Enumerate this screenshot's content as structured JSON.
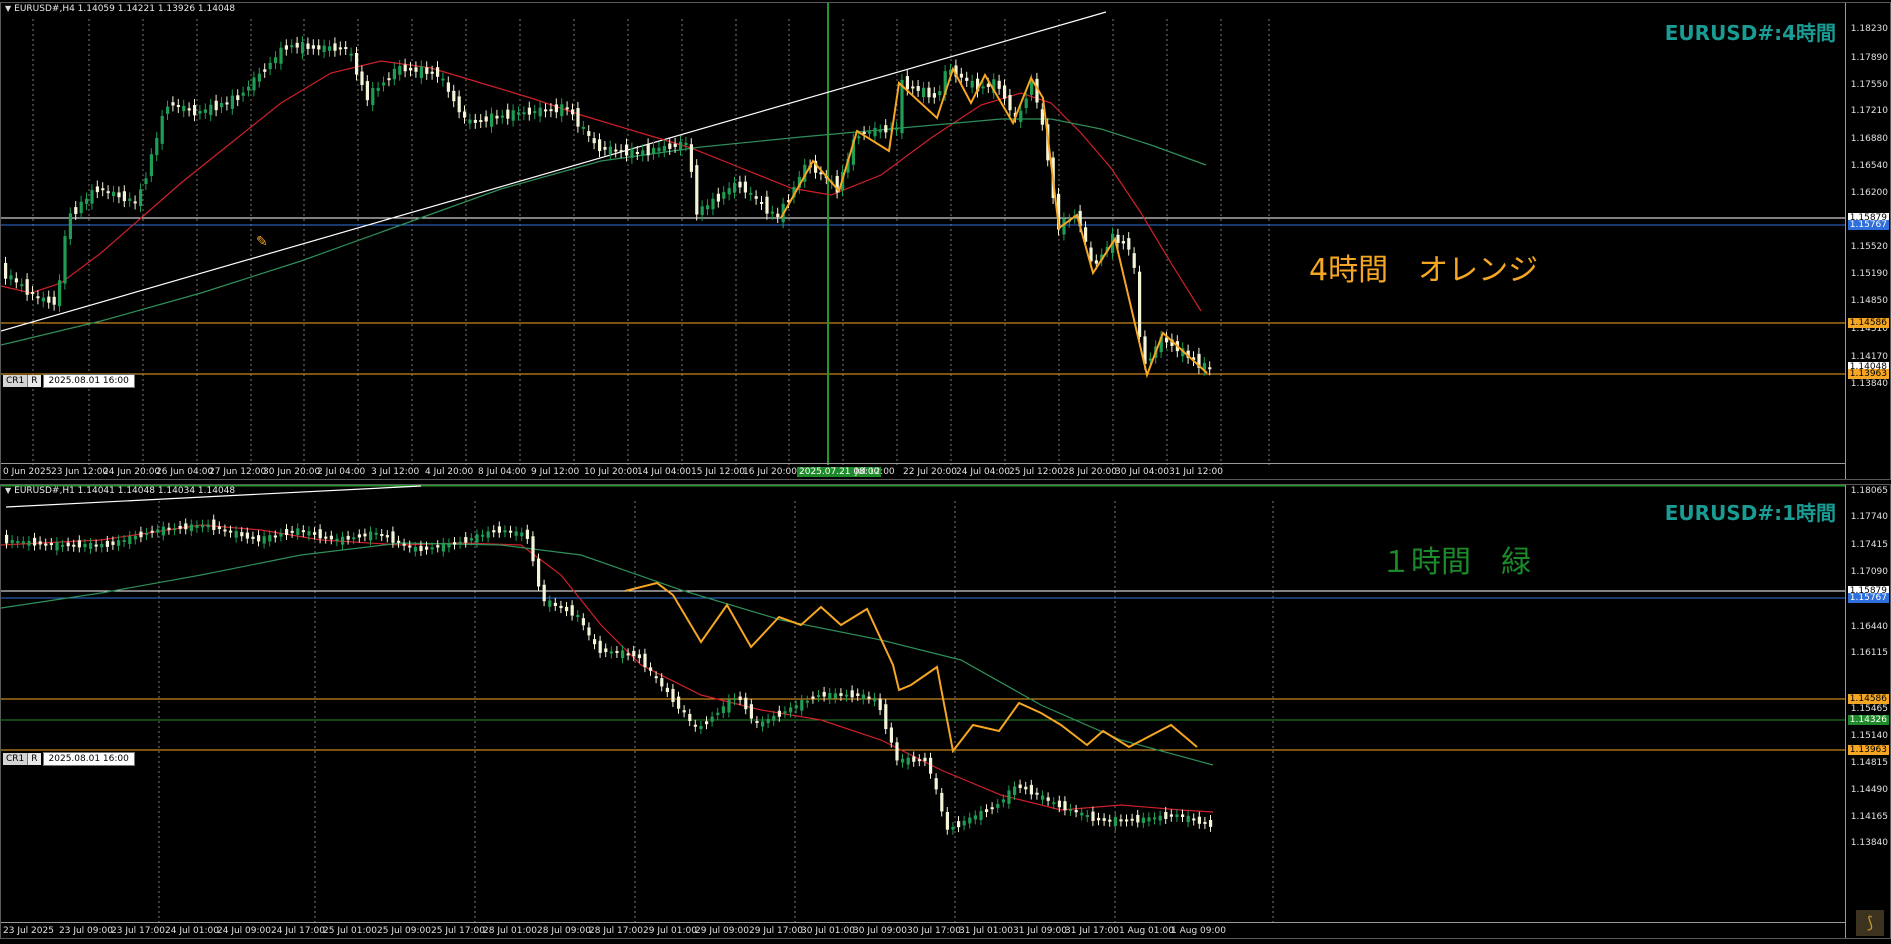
{
  "top": {
    "header": "EURUSD#,H4  1.14059 1.14221 1.13926 1.14048",
    "watermark": "EURUSD#:4時間",
    "annotation": "4時間　オレンジ",
    "annotation_color": "#f5a623",
    "date_box": "2025.08.01 16:00",
    "cr": "CR1",
    "r": "R",
    "price_ticks": [
      "1.18230",
      "1.17890",
      "1.17550",
      "1.17210",
      "1.16880",
      "1.16540",
      "1.16200",
      "1.15520",
      "1.15190",
      "1.14850",
      "1.14510",
      "1.14170",
      "1.13840"
    ],
    "price_boxes": [
      {
        "label": "1.15879",
        "bg": "#ffffff",
        "fg": "#000000"
      },
      {
        "label": "1.15767",
        "bg": "#2f6fdc",
        "fg": "#ffffff"
      },
      {
        "label": "1.14586",
        "bg": "#f5a623",
        "fg": "#000000"
      },
      {
        "label": "1.14048",
        "bg": "#ffffff",
        "fg": "#000000"
      },
      {
        "label": "1.13963",
        "bg": "#f5a623",
        "fg": "#000000"
      }
    ],
    "time_ticks": [
      "0 Jun 2025",
      "23 Jun 12:00",
      "24 Jun 20:00",
      "26 Jun 04:00",
      "27 Jun 12:00",
      "30 Jun 20:00",
      "2 Jul 04:00",
      "3 Jul 12:00",
      "4 Jul 20:00",
      "8 Jul 04:00",
      "9 Jul 12:00",
      "10 Jul 20:00",
      "14 Jul 04:00",
      "15 Jul 12:00",
      "16 Jul 20:00",
      "2025.07.21 08:00",
      "Jul 12:00",
      "22 Jul 20:00",
      "24 Jul 04:00",
      "25 Jul 12:00",
      "28 Jul 20:00",
      "30 Jul 04:00",
      "31 Jul 12:00"
    ]
  },
  "bottom": {
    "header": "EURUSD#,H1  1.14041 1.14048 1.14034 1.14048",
    "watermark": "EURUSD#:1時間",
    "annotation": "１時間　緑",
    "annotation_color": "#1a8a2a",
    "date_box": "2025.08.01 16:00",
    "cr": "CR1",
    "r": "R",
    "price_ticks": [
      "1.18065",
      "1.17740",
      "1.17415",
      "1.17090",
      "1.16765",
      "1.16440",
      "1.16115",
      "1.15465",
      "1.15140",
      "1.14815",
      "1.14490",
      "1.14165",
      "1.13840"
    ],
    "price_boxes": [
      {
        "label": "1.15879",
        "bg": "#ffffff",
        "fg": "#000000"
      },
      {
        "label": "1.15767",
        "bg": "#2f6fdc",
        "fg": "#ffffff"
      },
      {
        "label": "1.14586",
        "bg": "#f5a623",
        "fg": "#000000"
      },
      {
        "label": "1.14326",
        "bg": "#1f8a2a",
        "fg": "#ffffff"
      },
      {
        "label": "1.13963",
        "bg": "#f5a623",
        "fg": "#000000"
      }
    ],
    "time_ticks": [
      "23 Jul 2025",
      "23 Jul 09:00",
      "23 Jul 17:00",
      "24 Jul 01:00",
      "24 Jul 09:00",
      "24 Jul 17:00",
      "25 Jul 01:00",
      "25 Jul 09:00",
      "25 Jul 17:00",
      "28 Jul 01:00",
      "28 Jul 09:00",
      "28 Jul 17:00",
      "29 Jul 01:00",
      "29 Jul 09:00",
      "29 Jul 17:00",
      "30 Jul 01:00",
      "30 Jul 09:00",
      "30 Jul 17:00",
      "31 Jul 01:00",
      "31 Jul 09:00",
      "31 Jul 17:00",
      "1 Aug 01:00",
      "1 Aug 09:00"
    ]
  },
  "colors": {
    "bull": "#1f9d55",
    "bear": "#f4f4d8",
    "ma_fast": "#d0202a",
    "ma_slow": "#2f8f5a",
    "zigzag": "#f5a623",
    "grid": "#9a9a9a"
  }
}
